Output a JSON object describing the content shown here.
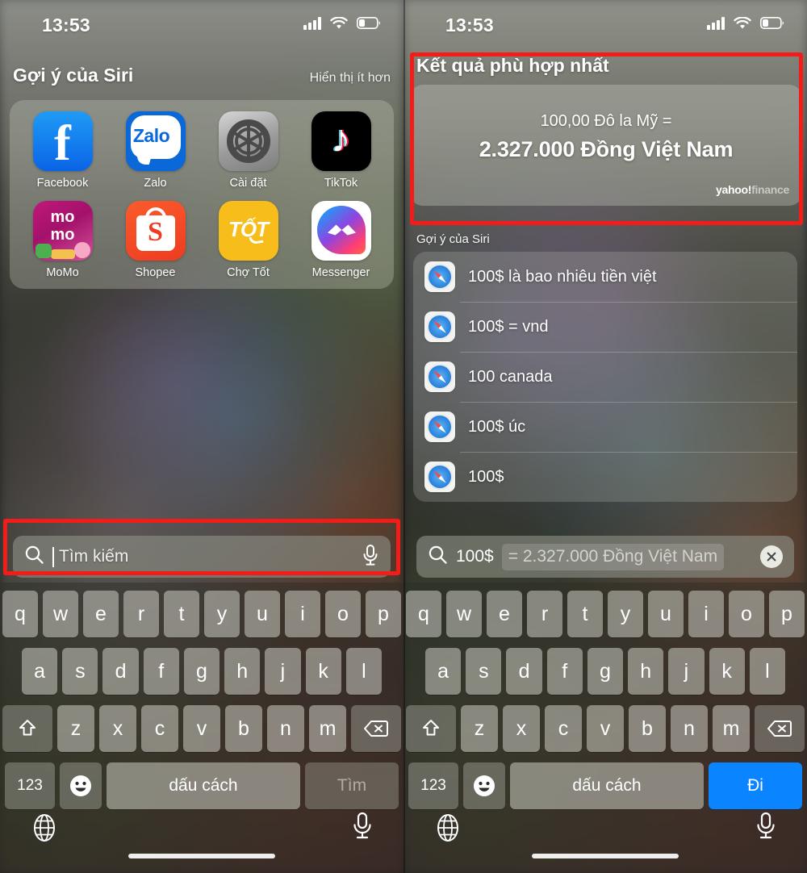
{
  "left": {
    "status": {
      "time": "13:53",
      "signal_icon": "cellular-bars-icon",
      "wifi_icon": "wifi-icon",
      "battery_icon": "battery-icon"
    },
    "siri_section": {
      "title": "Gợi ý của Siri",
      "show_less": "Hiển thị ít hơn"
    },
    "apps": [
      {
        "label": "Facebook",
        "icon": "facebook-icon",
        "glyph": "f",
        "color": "#0a64e6"
      },
      {
        "label": "Zalo",
        "icon": "zalo-icon",
        "glyph": "Zalo",
        "color": "#0a68d8"
      },
      {
        "label": "Cài đặt",
        "icon": "settings-gear-icon",
        "glyph": "",
        "color": "#9a9a9a"
      },
      {
        "label": "TikTok",
        "icon": "tiktok-icon",
        "glyph": "♪",
        "color": "#000000"
      },
      {
        "label": "MoMo",
        "icon": "momo-icon",
        "glyph": "mo\nmo",
        "color": "#a3116b"
      },
      {
        "label": "Shopee",
        "icon": "shopee-icon",
        "glyph": "S",
        "color": "#ee3c21"
      },
      {
        "label": "Chợ Tốt",
        "icon": "cho-tot-icon",
        "glyph": "TỐT",
        "color": "#f6bd1b"
      },
      {
        "label": "Messenger",
        "icon": "messenger-icon",
        "glyph": "",
        "color": "#8c46e0"
      }
    ],
    "search": {
      "placeholder": "Tìm kiếm",
      "value": "",
      "mic_icon": "microphone-icon",
      "search_icon": "magnifier-icon"
    },
    "keyboard": {
      "row1": [
        "q",
        "w",
        "e",
        "r",
        "t",
        "y",
        "u",
        "i",
        "o",
        "p"
      ],
      "row2": [
        "a",
        "s",
        "d",
        "f",
        "g",
        "h",
        "j",
        "k",
        "l"
      ],
      "row3": [
        "z",
        "x",
        "c",
        "v",
        "b",
        "n",
        "m"
      ],
      "shift_icon": "shift-arrow-icon",
      "backspace_icon": "backspace-icon",
      "numbers_label": "123",
      "emoji_icon": "emoji-smiley-icon",
      "space_label": "dấu cách",
      "action_label": "Tìm"
    },
    "bottom": {
      "globe_icon": "globe-icon",
      "mic_icon": "microphone-icon"
    }
  },
  "right": {
    "status": {
      "time": "13:53",
      "signal_icon": "cellular-bars-icon",
      "wifi_icon": "wifi-icon",
      "battery_icon": "battery-icon"
    },
    "best_match": {
      "title": "Kết quả phù hợp nhất",
      "from_amount": "100,00 Đô la Mỹ =",
      "to_amount": "2.327.000 Đồng Việt Nam",
      "source_a": "yahoo!",
      "source_b": "finance"
    },
    "siri_section": {
      "title": "Gợi ý của Siri"
    },
    "suggestions": [
      {
        "icon": "safari-icon",
        "text": "100$ là bao nhiêu tiền việt"
      },
      {
        "icon": "safari-icon",
        "text": "100$ = vnd"
      },
      {
        "icon": "safari-icon",
        "text": "100 canada"
      },
      {
        "icon": "safari-icon",
        "text": "100$ úc"
      },
      {
        "icon": "safari-icon",
        "text": "100$"
      }
    ],
    "search": {
      "value": "100$",
      "inline_completion": "=  2.327.000 Đồng Việt Nam",
      "clear_icon": "clear-x-icon",
      "search_icon": "magnifier-icon"
    },
    "keyboard": {
      "row1": [
        "q",
        "w",
        "e",
        "r",
        "t",
        "y",
        "u",
        "i",
        "o",
        "p"
      ],
      "row2": [
        "a",
        "s",
        "d",
        "f",
        "g",
        "h",
        "j",
        "k",
        "l"
      ],
      "row3": [
        "z",
        "x",
        "c",
        "v",
        "b",
        "n",
        "m"
      ],
      "shift_icon": "shift-arrow-icon",
      "backspace_icon": "backspace-icon",
      "numbers_label": "123",
      "emoji_icon": "emoji-smiley-icon",
      "space_label": "dấu cách",
      "action_label": "Đi"
    },
    "bottom": {
      "globe_icon": "globe-icon",
      "mic_icon": "microphone-icon"
    }
  },
  "annotations": {
    "highlight_color": "#f41c18",
    "boxes": [
      "left-search-field",
      "right-best-match-card"
    ]
  }
}
